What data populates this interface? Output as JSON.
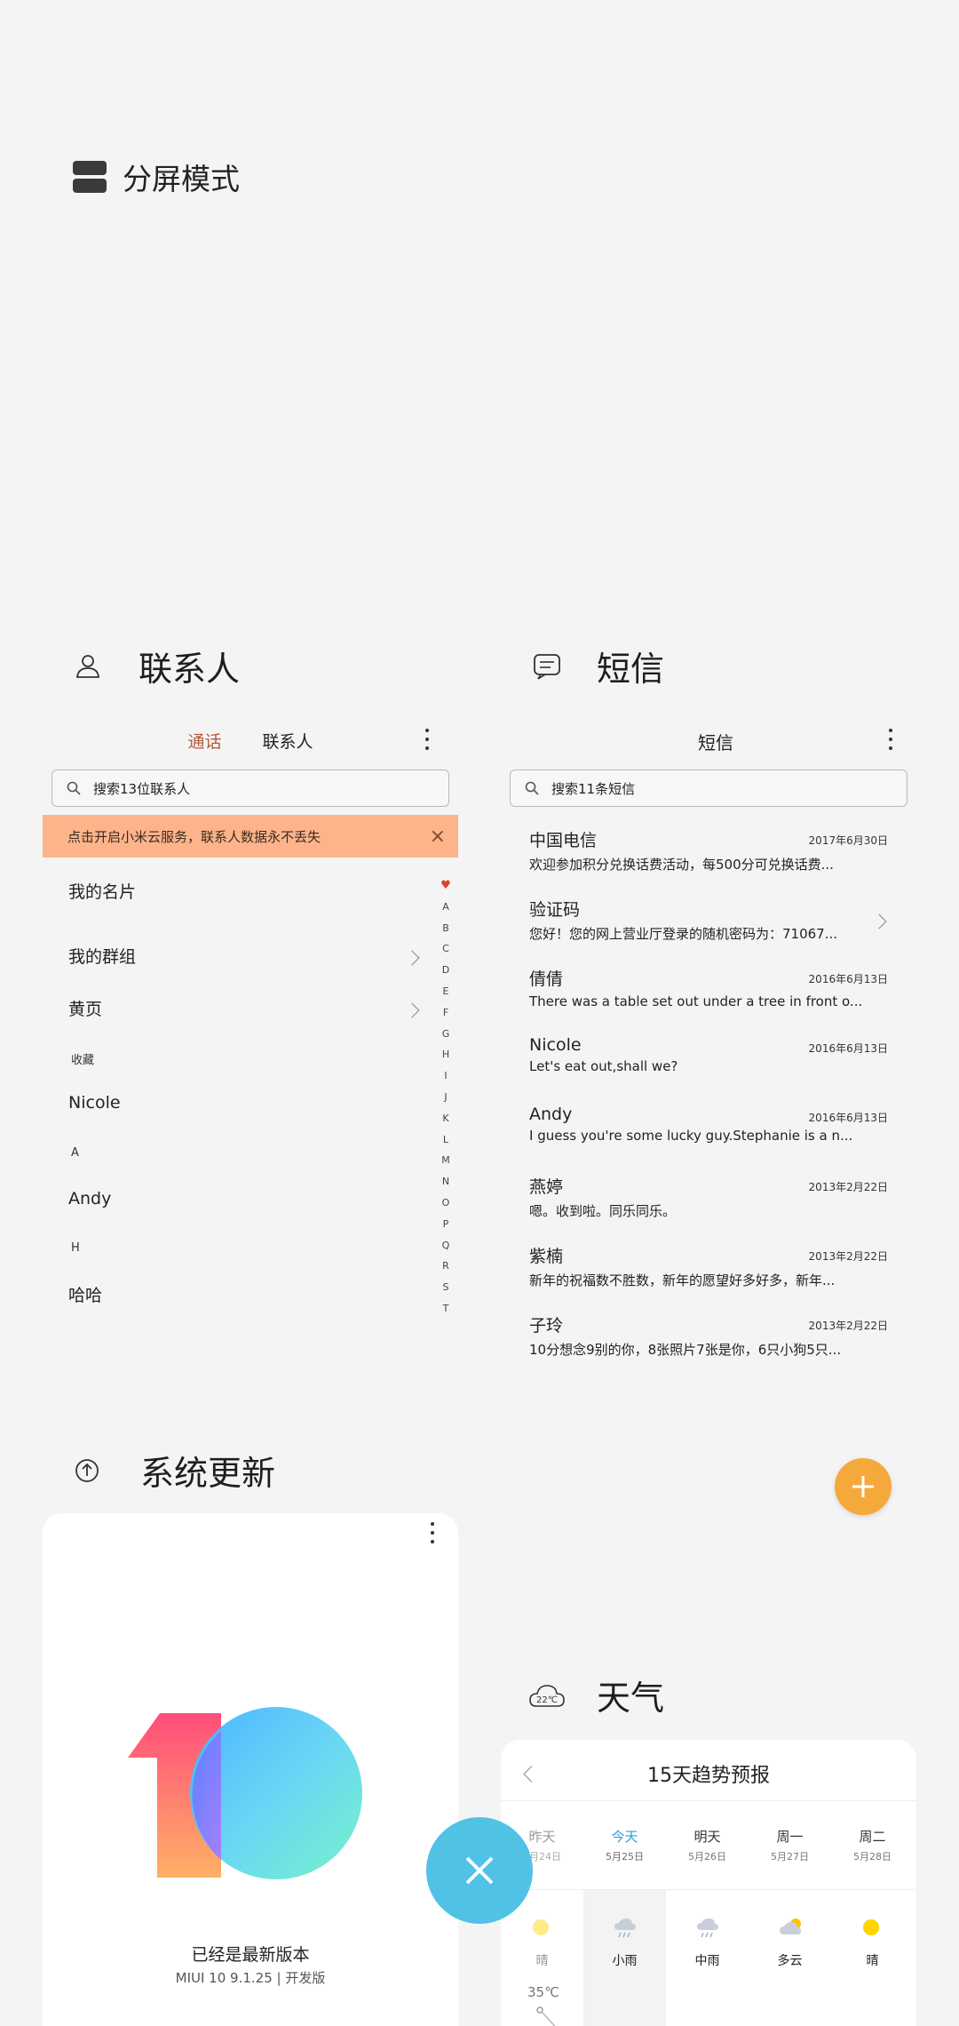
{
  "split_mode": {
    "label": "分屏模式",
    "icon": "split-screen-icon"
  },
  "contacts_app": {
    "title": "联系人",
    "icon": "person-icon",
    "tabs": [
      {
        "label": "通话",
        "active": true
      },
      {
        "label": "联系人",
        "active": false
      }
    ],
    "search_placeholder": "搜索13位联系人",
    "banner": {
      "text": "点击开启小米云服务，联系人数据永不丢失",
      "close": "×"
    },
    "my_card": "我的名片",
    "my_groups": "我的群组",
    "yellow_pages": "黄页",
    "sections": [
      {
        "header": "收藏",
        "name": "Nicole"
      },
      {
        "header": "A",
        "name": "Andy"
      },
      {
        "header": "H",
        "name": "哈哈"
      }
    ],
    "alpha_index": [
      "♥",
      "A",
      "B",
      "C",
      "D",
      "E",
      "F",
      "G",
      "H",
      "I",
      "J",
      "K",
      "L",
      "M",
      "N",
      "O",
      "P",
      "Q",
      "R",
      "S",
      "T"
    ]
  },
  "sms_app": {
    "title": "短信",
    "icon": "message-icon",
    "header": "短信",
    "search_placeholder": "搜索11条短信",
    "messages": [
      {
        "name": "中国电信",
        "date": "2017年6月30日",
        "preview": "欢迎参加积分兑换话费活动，每500分可兑换话费..."
      },
      {
        "name": "验证码",
        "date": "",
        "preview": "您好！您的网上营业厅登录的随机密码为：71067..."
      },
      {
        "name": "倩倩",
        "date": "2016年6月13日",
        "preview": "There was a table set out under a tree in front o..."
      },
      {
        "name": "Nicole",
        "date": "2016年6月13日",
        "preview": "Let's eat out,shall we?"
      },
      {
        "name": "Andy",
        "date": "2016年6月13日",
        "preview": "I guess you're some lucky guy.Stephanie is a n..."
      },
      {
        "name": "燕婷",
        "date": "2013年2月22日",
        "preview": "嗯。收到啦。同乐同乐。"
      },
      {
        "name": "紫楠",
        "date": "2013年2月22日",
        "preview": "新年的祝福数不胜数，新年的愿望好多好多，新年..."
      },
      {
        "name": "子玲",
        "date": "2013年2月22日",
        "preview": "10分想念9别的你，8张照片7张是你，6只小狗5只..."
      }
    ],
    "fab": "+"
  },
  "update_app": {
    "title": "系统更新",
    "icon": "upload-icon",
    "status": "已经是最新版本",
    "version": "MIUI 10 9.1.25 | 开发版"
  },
  "weather_app": {
    "title": "天气",
    "icon_text": "22℃",
    "header": "15天趋势预报",
    "days": [
      {
        "day": "昨天",
        "date": "5月24日",
        "condition": "晴",
        "icon": "sun-icon",
        "active": false
      },
      {
        "day": "今天",
        "date": "5月25日",
        "condition": "小雨",
        "icon": "rain-icon",
        "active": true
      },
      {
        "day": "明天",
        "date": "5月26日",
        "condition": "中雨",
        "icon": "rain-icon",
        "active": false
      },
      {
        "day": "周一",
        "date": "5月27日",
        "condition": "多云",
        "icon": "cloudy-icon",
        "active": false
      },
      {
        "day": "周二",
        "date": "5月28日",
        "condition": "晴",
        "icon": "sun-icon",
        "active": false
      }
    ],
    "temp_high": "35℃"
  },
  "close_button": "×",
  "colors": {
    "accent_tab": "#b35a3a",
    "banner": "#fdb48a",
    "fab": "#f6a93b",
    "close": "#4fc2e6",
    "today": "#2c9fd8"
  }
}
